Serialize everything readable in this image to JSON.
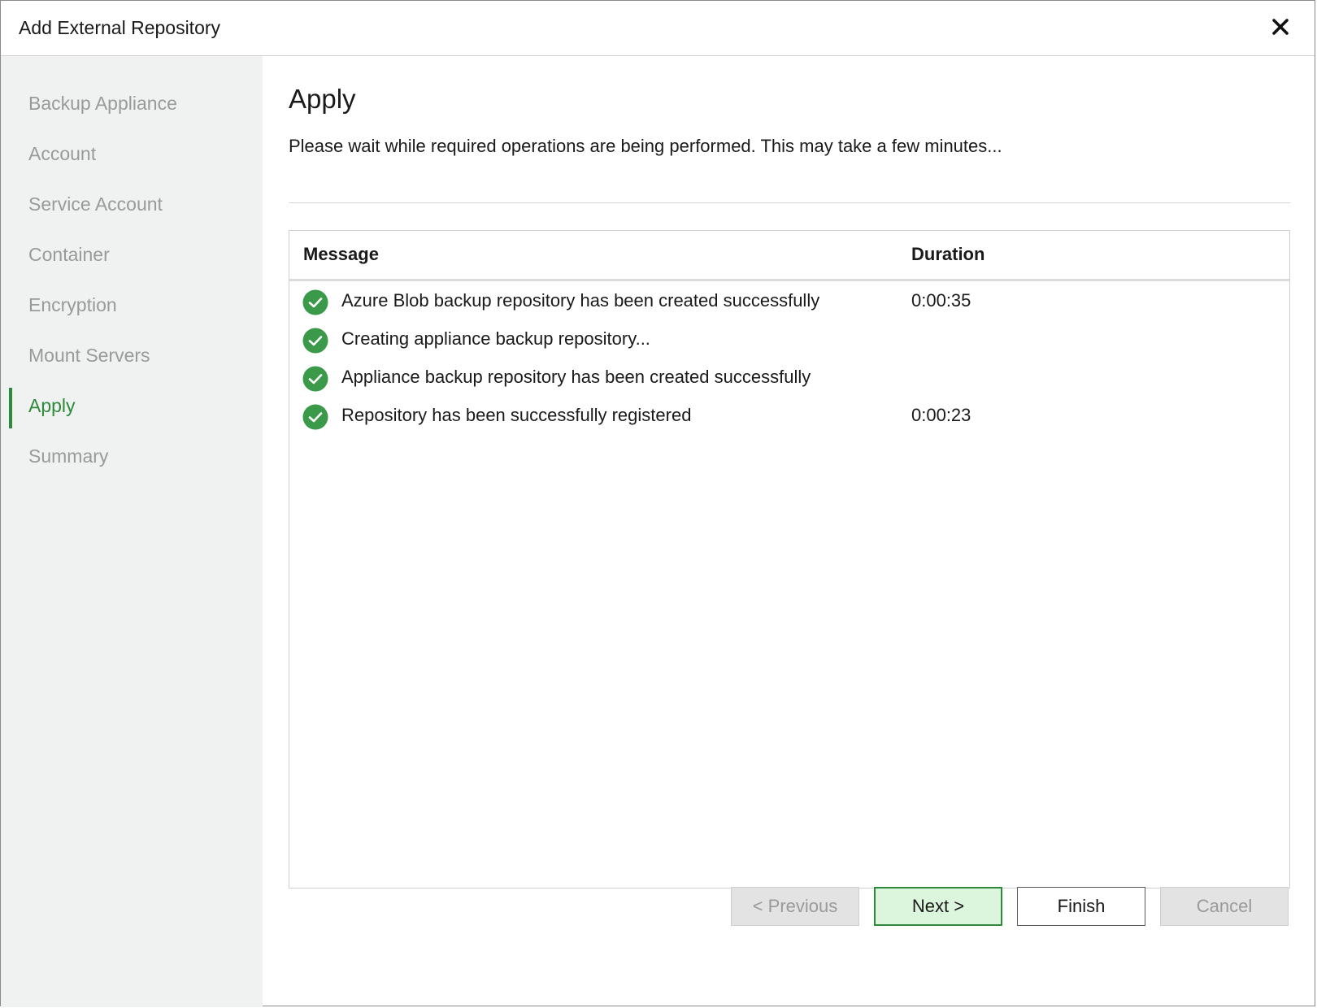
{
  "window": {
    "title": "Add External Repository"
  },
  "sidebar": {
    "steps": [
      {
        "label": "Backup Appliance",
        "active": false
      },
      {
        "label": "Account",
        "active": false
      },
      {
        "label": "Service Account",
        "active": false
      },
      {
        "label": "Container",
        "active": false
      },
      {
        "label": "Encryption",
        "active": false
      },
      {
        "label": "Mount Servers",
        "active": false
      },
      {
        "label": "Apply",
        "active": true
      },
      {
        "label": "Summary",
        "active": false
      }
    ]
  },
  "main": {
    "heading": "Apply",
    "description": "Please wait while required operations are being performed. This may take a few minutes...",
    "log": {
      "columns": {
        "message": "Message",
        "duration": "Duration"
      },
      "rows": [
        {
          "status": "success",
          "icon": "check-circle-icon",
          "message": "Azure Blob backup repository has been created successfully",
          "duration": "0:00:35"
        },
        {
          "status": "success",
          "icon": "check-circle-icon",
          "message": "Creating appliance backup repository...",
          "duration": ""
        },
        {
          "status": "success",
          "icon": "check-circle-icon",
          "message": "Appliance backup repository has been created successfully",
          "duration": ""
        },
        {
          "status": "success",
          "icon": "check-circle-icon",
          "message": "Repository has been successfully registered",
          "duration": "0:00:23"
        }
      ]
    }
  },
  "footer": {
    "previous_label": "< Previous",
    "next_label": "Next >",
    "finish_label": "Finish",
    "cancel_label": "Cancel"
  },
  "colors": {
    "accent": "#2e8a3a",
    "success_icon": "#3a9a4a",
    "sidebar_bg": "#f0f1f1",
    "primary_button_bg": "#dcf6de"
  }
}
